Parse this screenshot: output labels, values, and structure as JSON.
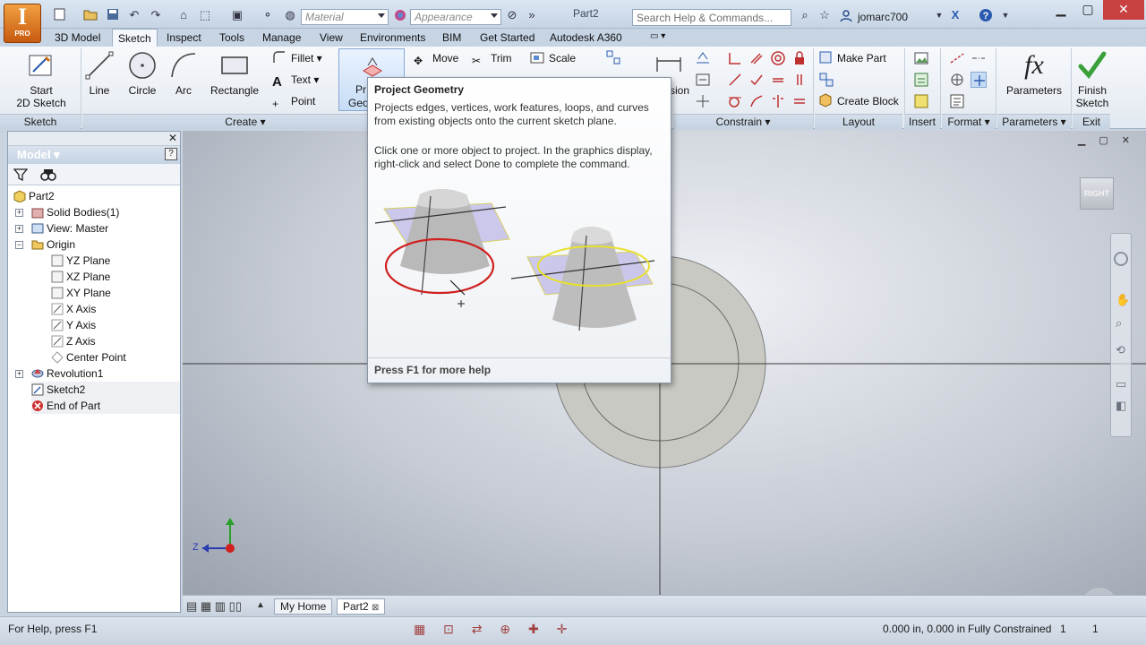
{
  "titlebar": {
    "material_value": "Material",
    "appearance_value": "Appearance",
    "document_title": "Part2",
    "search_placeholder": "Search Help & Commands...",
    "username": "jomarc700",
    "app_badge": "PRO"
  },
  "tabs": [
    "3D Model",
    "Sketch",
    "Inspect",
    "Tools",
    "Manage",
    "View",
    "Environments",
    "BIM",
    "Get Started",
    "Autodesk A360"
  ],
  "active_tab": "Sketch",
  "ribbon": {
    "sketch_panel": {
      "start_sketch_line1": "Start",
      "start_sketch_line2": "2D Sketch",
      "label": "Sketch"
    },
    "create_panel": {
      "line": "Line",
      "circle": "Circle",
      "arc": "Arc",
      "rectangle": "Rectangle",
      "fillet": "Fillet",
      "text": "Text",
      "point": "Point",
      "project_line1": "Pr",
      "project_line2": "Geo",
      "label": "Create"
    },
    "modify_panel": {
      "move": "Move",
      "trim": "Trim",
      "scale": "Scale"
    },
    "constrain_panel": {
      "dimension_partial": "sion",
      "label": "Constrain"
    },
    "layout_panel": {
      "make_part": "Make Part",
      "create_block": "Create Block",
      "label": "Layout"
    },
    "insert_panel": {
      "label": "Insert"
    },
    "format_panel": {
      "label": "Format"
    },
    "parameters_panel": {
      "parameters": "Parameters",
      "label": "Parameters"
    },
    "exit_panel": {
      "finish_line1": "Finish",
      "finish_line2": "Sketch",
      "label": "Exit"
    }
  },
  "tooltip": {
    "title": "Project Geometry",
    "description": "Projects edges, vertices, work features, loops, and curves from existing objects onto the current sketch plane.",
    "instruction": "Click one or more object to project. In the graphics display, right-click and select Done to complete the command.",
    "footer": "Press F1 for more help"
  },
  "browser": {
    "title": "Model",
    "items": [
      {
        "label": "Part2"
      },
      {
        "label": "Solid Bodies(1)"
      },
      {
        "label": "View: Master"
      },
      {
        "label": "Origin"
      },
      {
        "label": "YZ Plane"
      },
      {
        "label": "XZ Plane"
      },
      {
        "label": "XY Plane"
      },
      {
        "label": "X Axis"
      },
      {
        "label": "Y Axis"
      },
      {
        "label": "Z Axis"
      },
      {
        "label": "Center Point"
      },
      {
        "label": "Revolution1"
      },
      {
        "label": "Sketch2"
      },
      {
        "label": "End of Part"
      }
    ]
  },
  "viewport": {
    "viewcube_label": "RIGHT",
    "triad_z": "Z"
  },
  "doc_tabs": [
    "My Home",
    "Part2"
  ],
  "status": {
    "help": "For Help, press F1",
    "coords": "0.000 in, 0.000 in",
    "state": "Fully Constrained",
    "n1": "1",
    "n2": "1"
  },
  "icons": [
    "application-menu-icon",
    "new-icon",
    "open-icon",
    "save-icon",
    "undo-icon",
    "redo-icon",
    "home-icon",
    "search-icon",
    "star-icon",
    "user-icon",
    "help-icon",
    "filter-icon",
    "find-icon"
  ]
}
